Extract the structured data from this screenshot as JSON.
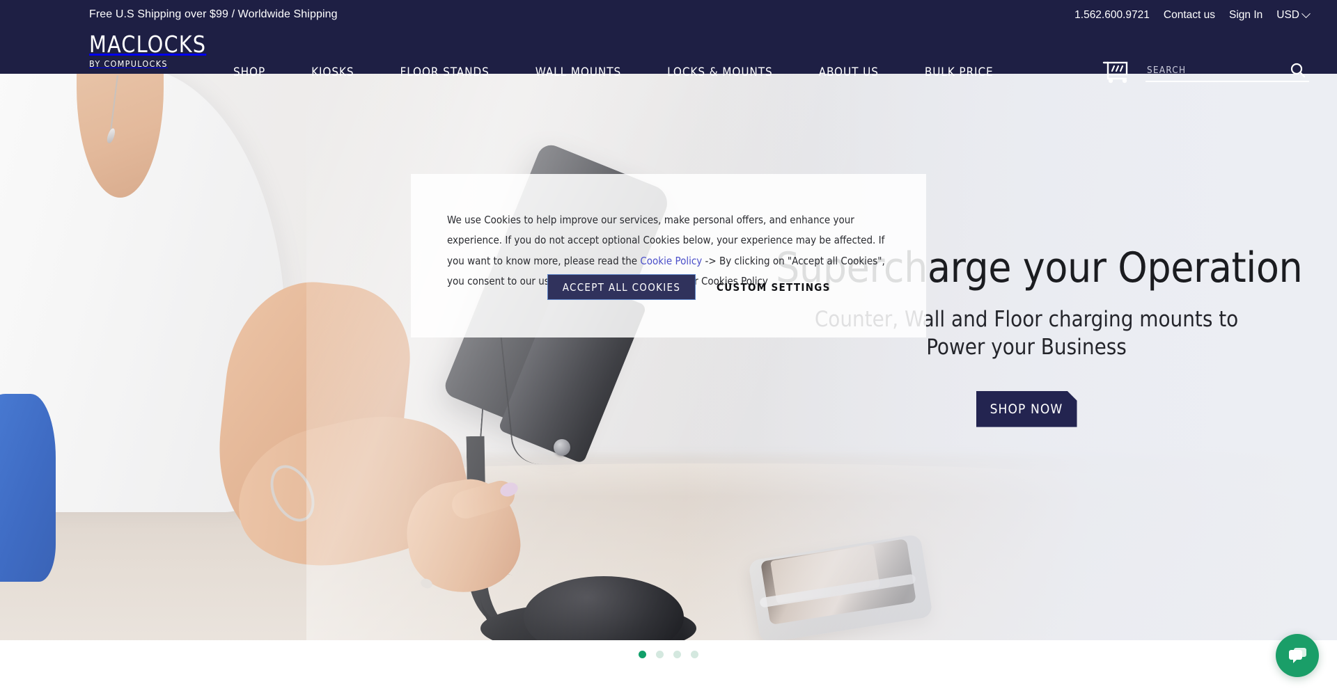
{
  "header": {
    "shipping_note": "Free U.S Shipping over $99 / Worldwide Shipping",
    "phone": "1.562.600.9721",
    "contact_label": "Contact us",
    "signin_label": "Sign In",
    "currency": "USD",
    "logo_main": "MACLOCKS",
    "logo_sub": "BY COMPULOCKS",
    "nav": [
      {
        "label": "SHOP"
      },
      {
        "label": "KIOSKS"
      },
      {
        "label": "FLOOR STANDS"
      },
      {
        "label": "WALL MOUNTS"
      },
      {
        "label": "LOCKS & MOUNTS"
      },
      {
        "label": "ABOUT US"
      },
      {
        "label": "BULK PRICE"
      }
    ],
    "search": {
      "placeholder": "SEARCH",
      "value": ""
    }
  },
  "hero": {
    "title": "Supercharge your Operation",
    "subtitle_line1": "Counter, Wall and Floor charging mounts to",
    "subtitle_line2": "Power your Business",
    "cta_label": "SHOP NOW"
  },
  "carousel": {
    "slides": [
      {
        "active": true
      },
      {
        "active": false
      },
      {
        "active": false
      },
      {
        "active": false
      }
    ]
  },
  "cookie": {
    "body_part1": "We use Cookies to help improve our services, make personal offers, and enhance your experience. If you do not accept optional Cookies below, your experience may be affected. If you want to know more, please read the ",
    "link_label": "Cookie Policy",
    "body_part2": " -> By clicking on \"Accept all Cookies\", you consent to our use of cookies as described in our Cookies Policy",
    "accept_label": "ACCEPT ALL COOKIES",
    "custom_label": "CUSTOM SETTINGS"
  },
  "colors": {
    "header_navy": "#1e1f44",
    "button_navy": "#232450",
    "accent_green": "#11a06a",
    "link_purple": "#4b4fc9",
    "dot_inactive": "#d4e8df"
  }
}
